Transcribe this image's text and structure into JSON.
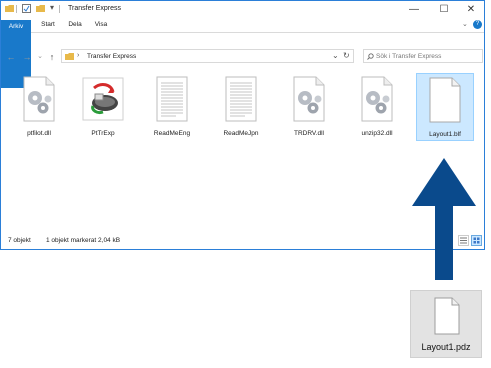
{
  "window": {
    "title": "Transfer Express",
    "controls": {
      "minimize": "—",
      "maximize": "☐",
      "close": "✕"
    }
  },
  "ribbon": {
    "tabs": [
      "Arkiv",
      "Start",
      "Dela",
      "Visa"
    ],
    "expand_glyph": "⌄",
    "help_glyph": "?"
  },
  "navigation": {
    "back": "←",
    "forward": "→",
    "recent": "⌄",
    "up": "↑",
    "breadcrumb": "Transfer Express",
    "breadcrumb_separator": "›",
    "dropdown": "⌄",
    "refresh": "↻"
  },
  "search": {
    "placeholder": "Sök i Transfer Express"
  },
  "files": [
    {
      "name": "ptfilot.dll",
      "icon": "gears-file-icon"
    },
    {
      "name": "PtTrExp",
      "icon": "transfer-app-icon"
    },
    {
      "name": "ReadMeEng",
      "icon": "text-document-icon"
    },
    {
      "name": "ReadMeJpn",
      "icon": "text-document-icon"
    },
    {
      "name": "TRDRV.dll",
      "icon": "gears-file-icon"
    },
    {
      "name": "unzip32.dll",
      "icon": "gears-file-icon"
    },
    {
      "name": "Layout1.blf",
      "icon": "blank-file-icon",
      "selected": true
    }
  ],
  "status": {
    "count": "7 objekt",
    "selection": "1 objekt markerat  2,04 kB"
  },
  "dragged_file": {
    "name": "Layout1.pdz",
    "icon": "blank-file-icon"
  },
  "colors": {
    "accent": "#1979ca",
    "arrow": "#0a4a8c",
    "selection": "#cce8ff"
  }
}
